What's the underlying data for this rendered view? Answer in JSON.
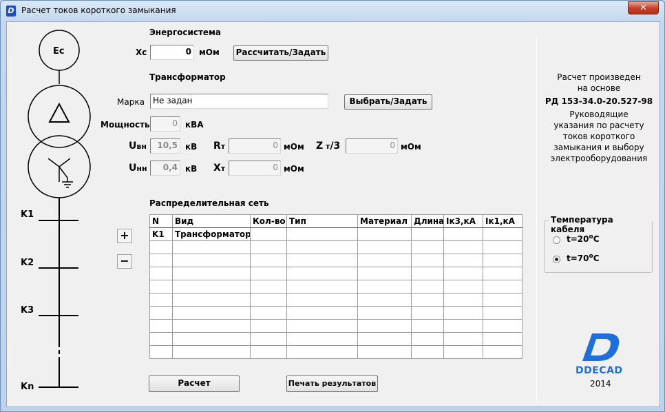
{
  "window": {
    "title": "Расчет токов короткого замыкания",
    "close_glyph": "✕"
  },
  "energy": {
    "heading": "Энергосистема",
    "xc_label": "Хс",
    "xc_value": "0",
    "xc_unit": "мОм",
    "calc_button": "Рассчитать/Задать"
  },
  "transformer": {
    "heading": "Трансформатор",
    "mark_label": "Марка",
    "mark_value": "Не задан",
    "choose_button": "Выбрать/Задать",
    "power_label": "Мощность",
    "power_value": "0",
    "power_unit": "кВА",
    "uvn_label": "U",
    "uvn_sub": "вн",
    "uvn_value": "10,5",
    "uvn_unit": "кВ",
    "unn_label": "U",
    "unn_sub": "нн",
    "unn_value": "0,4",
    "unn_unit": "кВ",
    "rt_label": "R",
    "rt_sub": "т",
    "rt_value": "0",
    "rt_unit": "мОм",
    "xt_label": "X",
    "xt_sub": "т",
    "xt_value": "0",
    "xt_unit": "мОм",
    "zt_label": "Z",
    "zt_sub": "т",
    "zt_suffix": "/3",
    "zt_value": "0",
    "zt_unit": "мОм"
  },
  "network": {
    "heading": "Распределительная сеть",
    "columns": [
      "N",
      "Вид",
      "Кол-во",
      "Тип",
      "Материал",
      "Длина",
      "Iк3,кА",
      "Iк1,кА"
    ],
    "rows": [
      [
        "K1",
        "Трансформатор",
        "",
        "",
        "",
        "",
        "",
        ""
      ],
      [
        "",
        "",
        "",
        "",
        "",
        "",
        "",
        ""
      ],
      [
        "",
        "",
        "",
        "",
        "",
        "",
        "",
        ""
      ],
      [
        "",
        "",
        "",
        "",
        "",
        "",
        "",
        ""
      ],
      [
        "",
        "",
        "",
        "",
        "",
        "",
        "",
        ""
      ],
      [
        "",
        "",
        "",
        "",
        "",
        "",
        "",
        ""
      ],
      [
        "",
        "",
        "",
        "",
        "",
        "",
        "",
        ""
      ],
      [
        "",
        "",
        "",
        "",
        "",
        "",
        "",
        ""
      ],
      [
        "",
        "",
        "",
        "",
        "",
        "",
        "",
        ""
      ],
      [
        "",
        "",
        "",
        "",
        "",
        "",
        "",
        ""
      ]
    ],
    "add_glyph": "+",
    "remove_glyph": "−"
  },
  "diagram": {
    "source_label": "Ес",
    "nodes": [
      "K1",
      "K2",
      "K3",
      "Kn"
    ]
  },
  "info": {
    "line1": "Расчет произведен",
    "line2": "на основе",
    "standard": "РД 153-34.0-20.527-98",
    "desc1": "Руководящие",
    "desc2": "указания по расчету",
    "desc3": "токов короткого",
    "desc4": "замыкания и выбору",
    "desc5": "электрооборудования"
  },
  "temperature": {
    "title": "Температура кабеля",
    "options": [
      {
        "label": "t=20",
        "sup": "o",
        "unit": "C",
        "selected": false
      },
      {
        "label": "t=70",
        "sup": "o",
        "unit": "C",
        "selected": true
      }
    ]
  },
  "actions": {
    "calculate": "Расчет",
    "print": "Печать результатов"
  },
  "brand": {
    "name": "DDECAD",
    "year": "2014",
    "color": "#1e6fd9"
  }
}
